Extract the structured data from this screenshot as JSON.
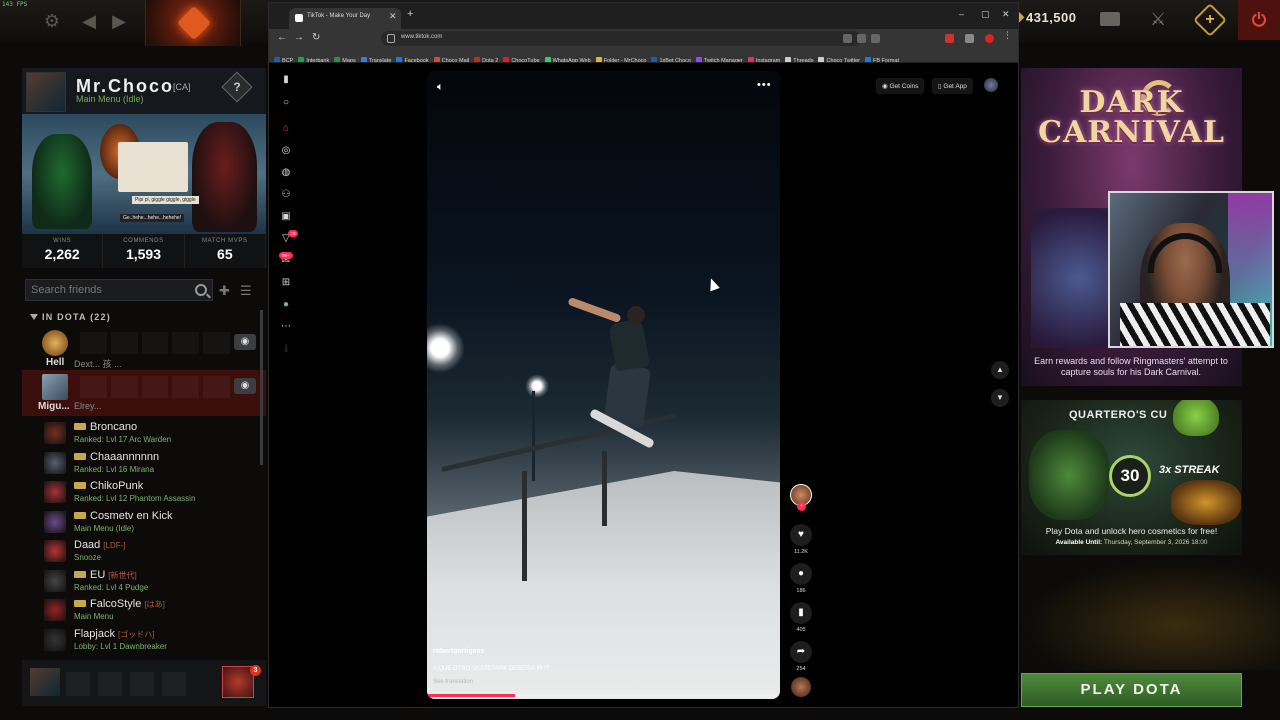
{
  "topbar": {
    "fps": "143 FPS",
    "shards": "431,500"
  },
  "profile": {
    "name": "Mr.Choco",
    "tag": "[CA]",
    "status": "Main Menu (Idle)",
    "help_label": "?",
    "showcase_text1": "Pipi pi, giggle giggle, giggle",
    "showcase_text2": "Ge..hehe...hehe...hehehe!",
    "stats": [
      {
        "label": "WINS",
        "value": "2,262"
      },
      {
        "label": "COMMENDS",
        "value": "1,593"
      },
      {
        "label": "MATCH MVPS",
        "value": "65"
      }
    ]
  },
  "friends": {
    "search_placeholder": "Search friends",
    "section_label": "IN DOTA (22)",
    "party_rows": [
      {
        "name": "Hell",
        "status": "Dext... 孩 ..."
      },
      {
        "name": "Migu...",
        "status": "Elrey..."
      }
    ],
    "eye_icon": "eye-icon",
    "list": [
      {
        "name": "Broncano",
        "tag": "",
        "status": "Ranked: Lvl 17 Arc Warden",
        "plus": true
      },
      {
        "name": "Chaaannnnnn",
        "tag": "",
        "status": "Ranked: Lvl 16 Mirana",
        "plus": true
      },
      {
        "name": "ChikoPunk",
        "tag": "",
        "status": "Ranked: Lvl 12 Phantom Assassin",
        "plus": true
      },
      {
        "name": "Cosmetv en Kick",
        "tag": "",
        "status": "Main Menu (Idle)",
        "plus": true
      },
      {
        "name": "Daad",
        "tag": "[LDF-]",
        "status": "Snooze",
        "plus": false
      },
      {
        "name": "EU",
        "tag": "[新世代]",
        "status": "Ranked: Lvl 4 Pudge",
        "plus": true
      },
      {
        "name": "FalcoStyle",
        "tag": "[はあ]",
        "status": "Main Menu",
        "plus": true
      },
      {
        "name": "Flapjack",
        "tag": "[ゴッドハ]",
        "status": "Lobby: Lvl 1 Dawnbreaker",
        "plus": false
      }
    ],
    "invite_count": "3"
  },
  "browser": {
    "tab_title": "TikTok - Make Your Day",
    "url": "www.tiktok.com",
    "bookmarks": [
      {
        "label": "BCP",
        "color": "#1b5fb6"
      },
      {
        "label": "Interbank",
        "color": "#1aa34a"
      },
      {
        "label": "Maps",
        "color": "#2a8f3f"
      },
      {
        "label": "Translate",
        "color": "#3c7be6"
      },
      {
        "label": "Facebook",
        "color": "#1877f2"
      },
      {
        "label": "Choco Mail",
        "color": "#d64a3b"
      },
      {
        "label": "Dota 2",
        "color": "#b8321f"
      },
      {
        "label": "ChocoTube",
        "color": "#e02020"
      },
      {
        "label": "WhatsApp Web",
        "color": "#25d366"
      },
      {
        "label": "Folder - MrChoco",
        "color": "#e3b43b"
      },
      {
        "label": "1xBet Choco",
        "color": "#1f5fa8"
      },
      {
        "label": "Twitch Manager",
        "color": "#9146ff"
      },
      {
        "label": "Instagram",
        "color": "#e1306c"
      },
      {
        "label": "Threads",
        "color": "#cccccc"
      },
      {
        "label": "Choco Twitter",
        "color": "#cccccc"
      },
      {
        "label": "FB Format",
        "color": "#1877f2"
      }
    ]
  },
  "tiktok": {
    "get_coins": "Get Coins",
    "get_app": "Get App",
    "inbox_badge": "10",
    "messages_badge": "99+",
    "video": {
      "author": "robertoartigass",
      "caption": "A QUE OTRO SKATEPARK DEBERIA IR !?",
      "see_translation": "See translation",
      "progress": 0.25
    },
    "actions": [
      {
        "name": "like",
        "count": "11.2K"
      },
      {
        "name": "comment",
        "count": "186"
      },
      {
        "name": "save",
        "count": "405"
      },
      {
        "name": "share",
        "count": "254"
      }
    ]
  },
  "events": {
    "carnival_title": "DARK CARNIVAL",
    "carnival_text": "Earn rewards and follow Ringmasters' attempt to capture souls for his Dark Carnival.",
    "quest_title": "QUARTERO'S CU",
    "quest_number": "30",
    "quest_streak": "3x STREAK",
    "quest_desc": "Play Dota and unlock hero cosmetics for free!",
    "quest_until_label": "Available Until:",
    "quest_until_date": "Thursday, September 3, 2026 18:00"
  },
  "play_button": "PLAY DOTA"
}
